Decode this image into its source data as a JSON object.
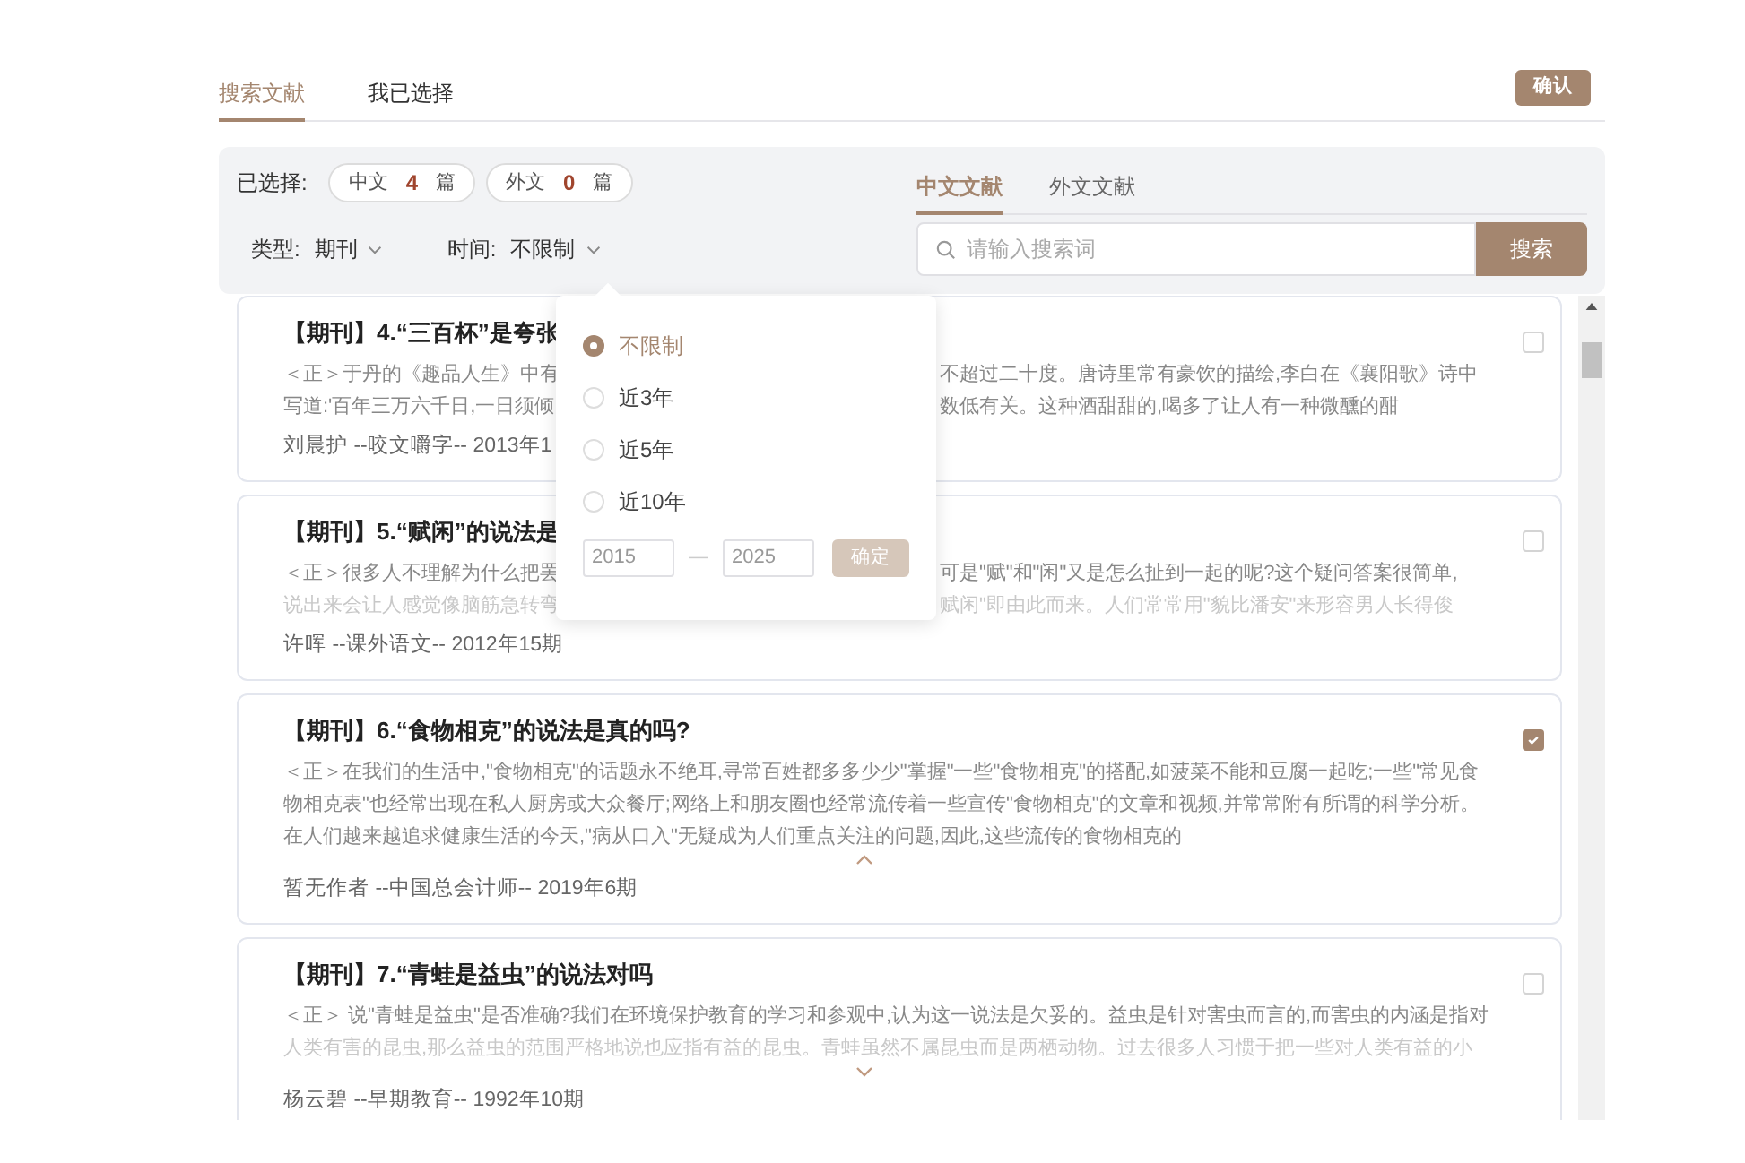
{
  "top_tabs": [
    {
      "label": "搜索文献",
      "selected": true
    },
    {
      "label": "我已选择",
      "selected": false
    }
  ],
  "confirm_button": "确认",
  "selected_summary": {
    "label": "已选择:",
    "chips": [
      {
        "lang": "中文",
        "count": "4",
        "unit": "篇"
      },
      {
        "lang": "外文",
        "count": "0",
        "unit": "篇"
      }
    ]
  },
  "filters": [
    {
      "label": "类型:",
      "value": "期刊"
    },
    {
      "label": "时间:",
      "value": "不限制"
    }
  ],
  "lang_tabs": [
    {
      "label": "中文文献",
      "selected": true
    },
    {
      "label": "外文文献",
      "selected": false
    }
  ],
  "search": {
    "placeholder": "请输入搜索词",
    "button": "搜索"
  },
  "time_popover": {
    "options": [
      {
        "label": "不限制",
        "selected": true
      },
      {
        "label": "近3年",
        "selected": false
      },
      {
        "label": "近5年",
        "selected": false
      },
      {
        "label": "近10年",
        "selected": false
      }
    ],
    "from": "2015",
    "separator": "—",
    "to": "2025",
    "button": "确定"
  },
  "results": [
    {
      "title": "【期刊】4.“三百杯”是夸张",
      "lines": [
        {
          "left": "＜正＞于丹的《趣品人生》中有",
          "right": "不超过二十度。唐诗里常有豪饮的描绘,李白在《襄阳歌》诗中"
        },
        {
          "left": "写道:'百年三万六千日,一日须倾",
          "right": "数低有关。这种酒甜甜的,喝多了让人有一种微醺的酣"
        }
      ],
      "meta": "刘晨护 --咬文嚼字-- 2013年1",
      "checked": false,
      "fade": false
    },
    {
      "title": "【期刊】5.“赋闲”的说法是",
      "lines": [
        {
          "left": "＜正＞很多人不理解为什么把罢",
          "right": "可是\"赋\"和\"闲\"又是怎么扯到一起的呢?这个疑问答案很简单,"
        },
        {
          "left": "说出来会让人感觉像脑筋急转弯",
          "right": "赋闲\"即由此而来。人们常常用\"貌比潘安\"来形容男人长得俊"
        }
      ],
      "meta": "许晖 --课外语文-- 2012年15期",
      "checked": false,
      "fade": true
    },
    {
      "title": "【期刊】6.“食物相克”的说法是真的吗?",
      "lines": [
        {
          "left": "＜正＞在我们的生活中,\"食物相克\"的话题永不绝耳,寻常百姓都多多少少\"掌握\"一些\"食物相克\"的搭配,如菠菜不能和豆腐一起吃;一些\"常见食"
        },
        {
          "left": "物相克表\"也经常出现在私人厨房或大众餐厅;网络上和朋友圈也经常流传着一些宣传\"食物相克\"的文章和视频,并常常附有所谓的科学分析。"
        },
        {
          "left": "在人们越来越追求健康生活的今天,\"病从口入\"无疑成为人们重点关注的问题,因此,这些流传的食物相克的"
        }
      ],
      "meta": "暂无作者 --中国总会计师-- 2019年6期",
      "checked": true,
      "fade": false,
      "expanded": true
    },
    {
      "title": "【期刊】7.“青蛙是益虫”的说法对吗",
      "lines": [
        {
          "left": "＜正＞ 说\"青蛙是益虫\"是否准确?我们在环境保护教育的学习和参观中,认为这一说法是欠妥的。益虫是针对害虫而言的,而害虫的内涵是指对"
        },
        {
          "left": "人类有害的昆虫,那么益虫的范围严格地说也应指有益的昆虫。青蛙虽然不属昆虫而是两栖动物。过去很多人习惯于把一些对人类有益的小"
        }
      ],
      "meta": "杨云碧 --早期教育-- 1992年10期",
      "checked": false,
      "fade": true,
      "expanded": false
    }
  ]
}
